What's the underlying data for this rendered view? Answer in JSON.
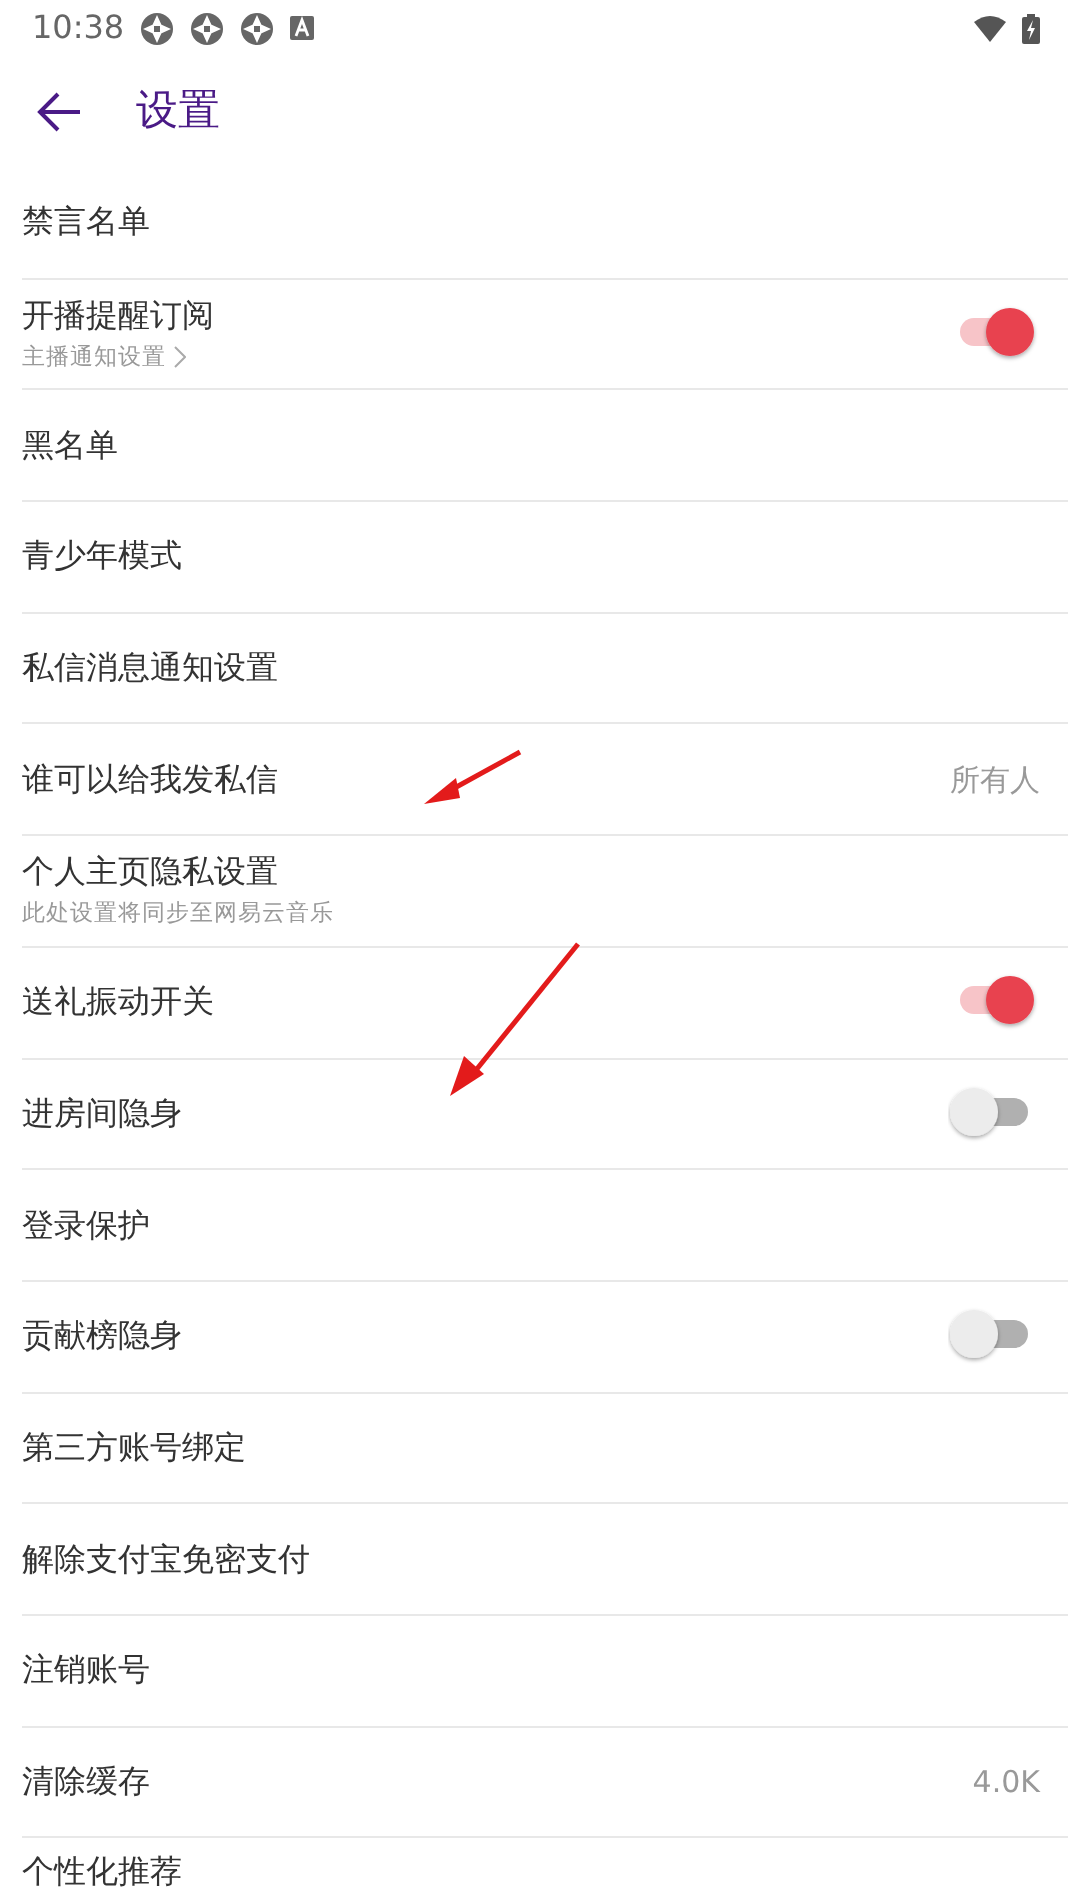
{
  "status_bar": {
    "time": "10:38"
  },
  "header": {
    "title": "设置"
  },
  "items": [
    {
      "kind": "plain",
      "label": "禁言名单"
    },
    {
      "kind": "toggle",
      "label": "开播提醒订阅",
      "subtitle": "主播通知设置",
      "subtitle_link": true,
      "on": true
    },
    {
      "kind": "plain",
      "label": "黑名单"
    },
    {
      "kind": "plain",
      "label": "青少年模式"
    },
    {
      "kind": "plain",
      "label": "私信消息通知设置"
    },
    {
      "kind": "value",
      "label": "谁可以给我发私信",
      "value": "所有人"
    },
    {
      "kind": "plain",
      "label": "个人主页隐私设置",
      "subtitle": "此处设置将同步至网易云音乐",
      "subtitle_link": false
    },
    {
      "kind": "toggle",
      "label": "送礼振动开关",
      "on": true
    },
    {
      "kind": "toggle",
      "label": "进房间隐身",
      "on": false
    },
    {
      "kind": "plain",
      "label": "登录保护"
    },
    {
      "kind": "toggle",
      "label": "贡献榜隐身",
      "on": false
    },
    {
      "kind": "plain",
      "label": "第三方账号绑定"
    },
    {
      "kind": "plain",
      "label": "解除支付宝免密支付"
    },
    {
      "kind": "plain",
      "label": "注销账号"
    },
    {
      "kind": "value",
      "label": "清除缓存",
      "value": "4.0K"
    },
    {
      "kind": "plain",
      "label": "个性化推荐"
    }
  ]
}
